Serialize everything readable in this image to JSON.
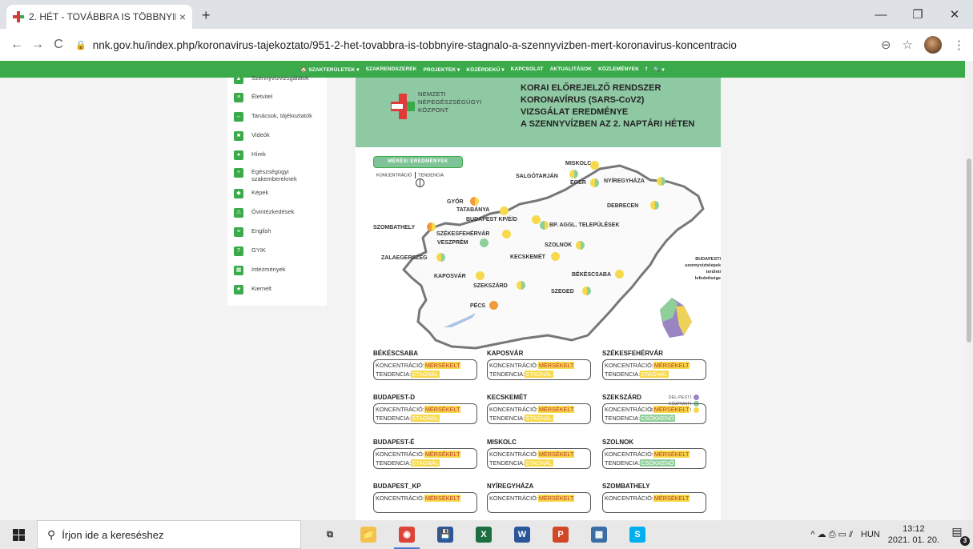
{
  "browser": {
    "tab_title": "2. HÉT - TOVÁBBRA IS TÖBBNYIR",
    "tab_close": "×",
    "new_tab": "+",
    "url": "nnk.gov.hu/index.php/koronavirus-tajekoztato/951-2-het-tovabbra-is-tobbnyire-stagnalo-a-szennyvizben-mert-koronavirus-koncentracio",
    "back": "←",
    "forward": "→",
    "reload": "C",
    "zoom_icon": "⊖",
    "star_icon": "☆",
    "menu_icon": "⋮",
    "win_min": "—",
    "win_max": "❐",
    "win_close": "✕"
  },
  "site_nav": {
    "items": [
      "🏠 SZAKTERÜLETEK ▾",
      "SZAKRENDSZEREK",
      "PROJEKTEK ▾",
      "KÖZÉRDEKŰ ▾",
      "KAPCSOLAT",
      "AKTUALITÁSOK",
      "KÖZLEMÉNYEK",
      "f",
      "🔍 ▾"
    ]
  },
  "sidebar": {
    "items": [
      {
        "label": "Szennyvízvizsgálatok",
        "icon": "▲"
      },
      {
        "label": "Életvitel",
        "icon": "≡"
      },
      {
        "label": "Tanácsok, tájékoztatók",
        "icon": "↔"
      },
      {
        "label": "Videók",
        "icon": "■"
      },
      {
        "label": "Hírek",
        "icon": "●"
      },
      {
        "label": "Egészségügyi szakembereknek",
        "icon": "+"
      },
      {
        "label": "Képek",
        "icon": "◆"
      },
      {
        "label": "Óvintézkedések",
        "icon": "⚠"
      },
      {
        "label": "English",
        "icon": "≡"
      },
      {
        "label": "GYIK",
        "icon": "?"
      },
      {
        "label": "Intézmények",
        "icon": "▦"
      },
      {
        "label": "Kiemelt",
        "icon": "★"
      }
    ]
  },
  "header": {
    "org_lines": [
      "NEMZETI",
      "NÉPEGÉSZSÉGÜGYI",
      "KÖZPONT"
    ],
    "logo_text": "NNK",
    "title_lines": [
      "KORAI ELŐREJELZŐ RENDSZER",
      "KORONAVÍRUS (SARS-CoV2)",
      "VIZSGÁLAT EREDMÉNYE",
      "A SZENNYVÍZBEN AZ 2. NAPTÁRI HÉTEN"
    ]
  },
  "map": {
    "badge": "MÉRÉSI EREDMÉNYEK",
    "legend_konc": "KONCENTRÁCIÓ",
    "legend_tend": "TENDENCIA",
    "colors": {
      "yellow": "#f7d94c",
      "green": "#8fcf9a",
      "orange": "#f29a3a",
      "purple": "#9a84c4"
    },
    "cities": [
      {
        "name": "MISKOLC",
        "l": "yellow",
        "r": "yellow"
      },
      {
        "name": "SALGÓTARJÁN",
        "l": "yellow",
        "r": "green"
      },
      {
        "name": "EGER",
        "l": "yellow",
        "r": "green"
      },
      {
        "name": "NYÍREGYHÁZA",
        "l": "yellow",
        "r": "green"
      },
      {
        "name": "DEBRECEN",
        "l": "yellow",
        "r": "green"
      },
      {
        "name": "GYŐR",
        "l": "orange",
        "r": "yellow"
      },
      {
        "name": "TATABÁNYA",
        "l": "yellow",
        "r": "yellow"
      },
      {
        "name": "BUDAPEST KP/É/D",
        "l": "yellow",
        "r": "yellow"
      },
      {
        "name": "BP. AGGL. TELEPÜLÉSEK",
        "l": "green",
        "r": "yellow"
      },
      {
        "name": "SZOMBATHELY",
        "l": "orange",
        "r": "yellow"
      },
      {
        "name": "SZÉKESFEHÉRVÁR",
        "l": "yellow",
        "r": "yellow"
      },
      {
        "name": "VESZPRÉM",
        "l": "green",
        "r": "green"
      },
      {
        "name": "SZOLNOK",
        "l": "yellow",
        "r": "green"
      },
      {
        "name": "ZALAEGERSZEG",
        "l": "yellow",
        "r": "green"
      },
      {
        "name": "KECSKEMÉT",
        "l": "yellow",
        "r": "yellow"
      },
      {
        "name": "BÉKÉSCSABA",
        "l": "yellow",
        "r": "yellow"
      },
      {
        "name": "KAPOSVÁR",
        "l": "yellow",
        "r": "yellow"
      },
      {
        "name": "SZEKSZÁRD",
        "l": "yellow",
        "r": "green"
      },
      {
        "name": "SZEGED",
        "l": "yellow",
        "r": "green"
      },
      {
        "name": "PÉCS",
        "l": "orange",
        "r": "orange"
      }
    ],
    "bud_label_lines": [
      "BUDAPESTI",
      "szennyvíztelepek",
      "területi",
      "lefedettsége"
    ],
    "bud_legend": [
      {
        "label": "DÉL-PESTI",
        "color": "#9a84c4"
      },
      {
        "label": "KÖZPONTI",
        "color": "#8fcf9a"
      },
      {
        "label": "ÉSZAK-BUDAPESTI",
        "color": "#f7d94c"
      }
    ]
  },
  "results": {
    "konc_label": "KONCENTRÁCIÓ:",
    "tend_label": "TENDENCIA:",
    "cards": [
      {
        "name": "BÉKÉSCSABA",
        "konc": "MÉRSÉKELT",
        "tend": "STAGNÁL",
        "tc": "#f7d94c"
      },
      {
        "name": "KAPOSVÁR",
        "konc": "MÉRSÉKELT",
        "tend": "STAGNÁL",
        "tc": "#f7d94c"
      },
      {
        "name": "SZÉKESFEHÉRVÁR",
        "konc": "MÉRSÉKELT",
        "tend": "STAGNÁL",
        "tc": "#f7d94c"
      },
      {
        "name": "BUDAPEST-D",
        "konc": "MÉRSÉKELT",
        "tend": "STAGNÁL",
        "tc": "#f7d94c"
      },
      {
        "name": "KECSKEMÉT",
        "konc": "MÉRSÉKELT",
        "tend": "STAGNÁL",
        "tc": "#f7d94c"
      },
      {
        "name": "SZEKSZÁRD",
        "konc": "MÉRSÉKELT",
        "tend": "CSÖKKENŐ",
        "tc": "#8fcf9a"
      },
      {
        "name": "BUDAPEST-É",
        "konc": "MÉRSÉKELT",
        "tend": "STAGNÁL",
        "tc": "#f7d94c"
      },
      {
        "name": "MISKOLC",
        "konc": "MÉRSÉKELT",
        "tend": "STAGNÁL",
        "tc": "#f7d94c"
      },
      {
        "name": "SZOLNOK",
        "konc": "MÉRSÉKELT",
        "tend": "CSÖKKENŐ",
        "tc": "#8fcf9a"
      },
      {
        "name": "BUDAPEST_KP",
        "konc": "MÉRSÉKELT",
        "tend": "",
        "tc": "#f7d94c"
      },
      {
        "name": "NYÍREGYHÁZA",
        "konc": "MÉRSÉKELT",
        "tend": "",
        "tc": "#f7d94c"
      },
      {
        "name": "SZOMBATHELY",
        "konc": "MÉRSÉKELT",
        "tend": "",
        "tc": "#f7d94c"
      }
    ]
  },
  "taskbar": {
    "search_placeholder": "Írjon ide a kereséshez",
    "apps": [
      {
        "name": "task-view",
        "glyph": "⧉",
        "color": "#e8e8e8",
        "fg": "#333"
      },
      {
        "name": "file-explorer",
        "glyph": "📁",
        "color": "#f2c14e",
        "fg": "#fff"
      },
      {
        "name": "chrome",
        "glyph": "◉",
        "color": "#db4437",
        "fg": "#fff"
      },
      {
        "name": "save-app",
        "glyph": "💾",
        "color": "#2b5797",
        "fg": "#fff"
      },
      {
        "name": "excel",
        "glyph": "X",
        "color": "#1d6f42",
        "fg": "#fff"
      },
      {
        "name": "word",
        "glyph": "W",
        "color": "#2b579a",
        "fg": "#fff"
      },
      {
        "name": "powerpoint",
        "glyph": "P",
        "color": "#d24726",
        "fg": "#fff"
      },
      {
        "name": "grid-app",
        "glyph": "▦",
        "color": "#3a6ea5",
        "fg": "#fff"
      },
      {
        "name": "skype",
        "glyph": "S",
        "color": "#00aff0",
        "fg": "#fff"
      }
    ],
    "tray_icons": "^ ☁ ⎙ ▭ ⫽",
    "lang": "HUN",
    "time": "13:12",
    "date": "2021. 01. 20.",
    "notif_count": "3"
  }
}
